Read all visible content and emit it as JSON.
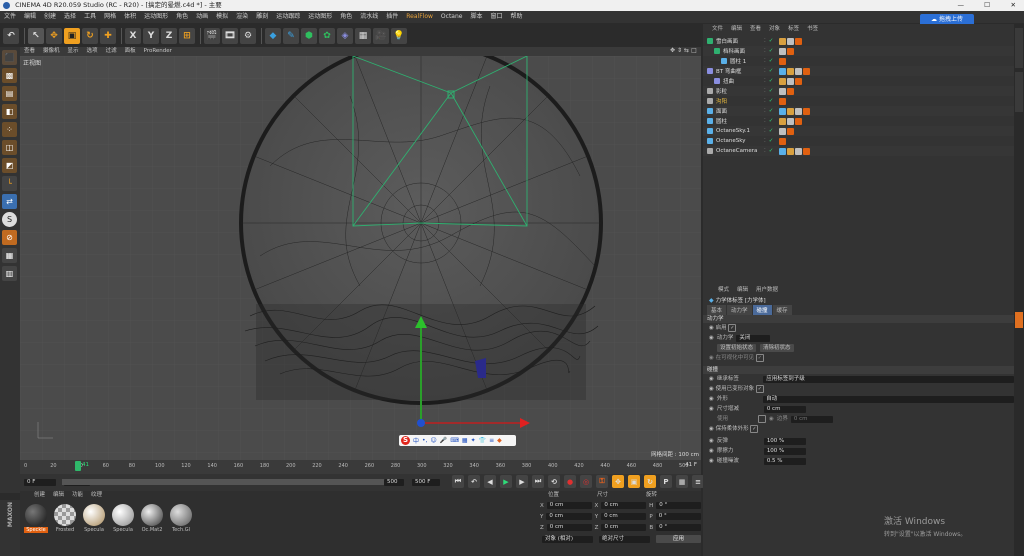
{
  "titlebar": {
    "title": "CINEMA 4D R20.059 Studio (RC - R20) - [搞定的晕燃.c4d *] - 主要"
  },
  "menu": [
    "文件",
    "编辑",
    "创建",
    "选择",
    "工具",
    "网格",
    "体积",
    "运动图形",
    "角色",
    "动画",
    "模拟",
    "渲染",
    "雕刻",
    "运动跟踪",
    "运动图形",
    "角色",
    "流水线",
    "插件",
    "RealFlow",
    "Octane",
    "脚本",
    "窗口",
    "帮助"
  ],
  "upload_button": "拖拽上传",
  "viewport": {
    "menu": [
      "查看",
      "摄像机",
      "显示",
      "选项",
      "过滤",
      "面板",
      "ProRender"
    ],
    "label": "正视图",
    "grid_label": "网格间距 : 100 cm"
  },
  "timeline": {
    "ticks": [
      "0",
      "20",
      "40",
      "60",
      "80",
      "100",
      "120",
      "140",
      "160",
      "180",
      "200",
      "220",
      "240",
      "260",
      "280",
      "300",
      "320",
      "340",
      "360",
      "380",
      "400",
      "420",
      "440",
      "460",
      "480",
      "500"
    ],
    "current_frame": "41",
    "end_label": "41 F"
  },
  "transport": {
    "start": "0 F",
    "min": "0 F",
    "range": "500",
    "max": "500 F"
  },
  "materials": {
    "menu": [
      "创建",
      "编辑",
      "功能",
      "纹理"
    ],
    "items": [
      "Speckle",
      "Frosted",
      "Specula",
      "Specula",
      "Oc.Mat2",
      "Tech.Gl"
    ]
  },
  "coords": {
    "headers": [
      "位置",
      "尺寸",
      "旋转"
    ],
    "rows": [
      {
        "axis": "X",
        "pos": "0 cm",
        "size_axis": "X",
        "size": "0 cm",
        "rot_axis": "H",
        "rot": "0 °"
      },
      {
        "axis": "Y",
        "pos": "0 cm",
        "size_axis": "Y",
        "size": "0 cm",
        "rot_axis": "P",
        "rot": "0 °"
      },
      {
        "axis": "Z",
        "pos": "0 cm",
        "size_axis": "Z",
        "size": "0 cm",
        "rot_axis": "B",
        "rot": "0 °"
      }
    ],
    "mode": "对象 (相对)",
    "size_mode": "绝对尺寸",
    "apply": "应用"
  },
  "objects": {
    "menu": [
      "文件",
      "编辑",
      "查看",
      "对象",
      "标签",
      "书签"
    ],
    "items": [
      {
        "name": "雪白画面",
        "indent": 0
      },
      {
        "name": "档科画面",
        "indent": 1
      },
      {
        "name": "圆柱 1",
        "indent": 2
      },
      {
        "name": "BT 弯曲框",
        "indent": 0
      },
      {
        "name": "扭曲",
        "indent": 1
      },
      {
        "name": "影粒",
        "indent": 0
      },
      {
        "name": "沟阳",
        "indent": 0,
        "highlight": true
      },
      {
        "name": "面面",
        "indent": 0
      },
      {
        "name": "圆柱",
        "indent": 0
      },
      {
        "name": "OctaneSky.1",
        "indent": 0
      },
      {
        "name": "OctaneSky",
        "indent": 0
      },
      {
        "name": "OctaneCamera",
        "indent": 0
      }
    ]
  },
  "attributes": {
    "menu": [
      "模式",
      "编辑",
      "用户数据"
    ],
    "title": "力学体标签 [力学体]",
    "tabs": [
      "基本",
      "动力学",
      "碰撞",
      "缓存"
    ],
    "active_tab": "碰撞",
    "dynamics_head": "动力学",
    "enabled_label": "启用",
    "dynamic_label": "动力学",
    "dynamic_value": "关闭",
    "btn_set_initial": "设置初始状态",
    "btn_clear_initial": "清除初状态",
    "vis_label": "在可视化中可见",
    "collision_head": "碰撞",
    "inherit_label": "继承标签",
    "inherit_value": "应用标签到子级",
    "deform_label": "使用已变形对象",
    "shape_label": "外形",
    "shape_value": "自动",
    "size_inc_label": "尺寸增减",
    "size_inc_value": "0 cm",
    "use_label": "使用",
    "border_label": "边界",
    "border_value": "0 cm",
    "keep_shape_label": "保持柔体外形",
    "bounce_label": "反弹",
    "bounce_value": "100 %",
    "friction_label": "摩擦力",
    "friction_value": "100 %",
    "collision_noise_label": "碰撞噪波",
    "collision_noise_value": "0.5 %"
  },
  "watermark": {
    "line1": "激活 Windows",
    "line2": "转到\"设置\"以激活 Windows。"
  },
  "maxon": "MAXON"
}
